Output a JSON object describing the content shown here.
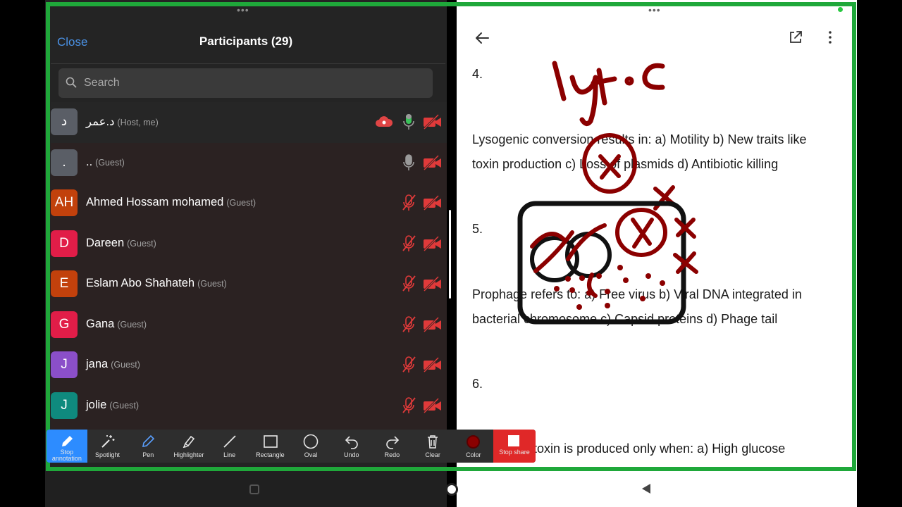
{
  "participants_panel": {
    "close_label": "Close",
    "title": "Participants (29)",
    "search_placeholder": "Search",
    "participants": [
      {
        "initials": "د",
        "name": "د.عمر",
        "role": "(Host, me)",
        "avatar_color": "#5a5e66",
        "mic": "on",
        "camera": "off",
        "cloud_recording": true
      },
      {
        "initials": ".",
        "name": "..",
        "role": "(Guest)",
        "avatar_color": "#5a5e66",
        "mic": "available",
        "camera": "off"
      },
      {
        "initials": "AH",
        "name": "Ahmed Hossam mohamed",
        "role": "(Guest)",
        "avatar_color": "#c2410c",
        "mic": "muted",
        "camera": "off"
      },
      {
        "initials": "D",
        "name": "Dareen",
        "role": "(Guest)",
        "avatar_color": "#e11d48",
        "mic": "muted",
        "camera": "off"
      },
      {
        "initials": "E",
        "name": "Eslam Abo Shahateh",
        "role": "(Guest)",
        "avatar_color": "#c2410c",
        "mic": "muted",
        "camera": "off"
      },
      {
        "initials": "G",
        "name": "Gana",
        "role": "(Guest)",
        "avatar_color": "#e11d48",
        "mic": "muted",
        "camera": "off"
      },
      {
        "initials": "J",
        "name": "jana",
        "role": "(Guest)",
        "avatar_color": "#8b4fc9",
        "mic": "muted",
        "camera": "off"
      },
      {
        "initials": "J",
        "name": "jolie",
        "role": "(Guest)",
        "avatar_color": "#0f8a7e",
        "mic": "muted",
        "camera": "off"
      }
    ]
  },
  "document": {
    "lines": [
      {
        "text": "4."
      },
      {
        "text": "Lysogenic conversion results in: a) Motility     b) New traits like"
      },
      {
        "text": "toxin production     c) Loss of plasmids     d) Antibiotic killing"
      },
      {
        "text": "5."
      },
      {
        "text": "Prophage refers to: a) Free virus     b) Viral DNA integrated in"
      },
      {
        "text": "bacterial chromosome     c) Capsid proteins     d) Phage tail"
      },
      {
        "text": "6."
      },
      {
        "text": "Diphtheria toxin is produced only when: a) High glucose"
      }
    ]
  },
  "annotation_toolbar": {
    "tools": [
      {
        "id": "stop-annotation",
        "label": "Stop annotation",
        "icon": "pen-icon"
      },
      {
        "id": "spotlight",
        "label": "Spotlight",
        "icon": "magic-wand-icon"
      },
      {
        "id": "pen",
        "label": "Pen",
        "icon": "pen-icon"
      },
      {
        "id": "highlighter",
        "label": "Highlighter",
        "icon": "highlighter-icon"
      },
      {
        "id": "line",
        "label": "Line",
        "icon": "line-icon"
      },
      {
        "id": "rectangle",
        "label": "Rectangle",
        "icon": "rectangle-icon"
      },
      {
        "id": "oval",
        "label": "Oval",
        "icon": "oval-icon"
      },
      {
        "id": "undo",
        "label": "Undo",
        "icon": "undo-icon"
      },
      {
        "id": "redo",
        "label": "Redo",
        "icon": "redo-icon"
      },
      {
        "id": "clear",
        "label": "Clear",
        "icon": "trash-icon"
      },
      {
        "id": "color",
        "label": "Color",
        "icon": "color-swatch-icon"
      }
    ],
    "stop_share_label": "Stop share",
    "selected_color": "#8b0000"
  },
  "annotation": {
    "handwritten_text": "lytic",
    "ink_color": "#8b0000"
  },
  "colors": {
    "share_border": "#1fa83a",
    "accent_blue": "#2d8cff",
    "mute_red": "#e03a3a",
    "stop_share_red": "#e02828"
  }
}
